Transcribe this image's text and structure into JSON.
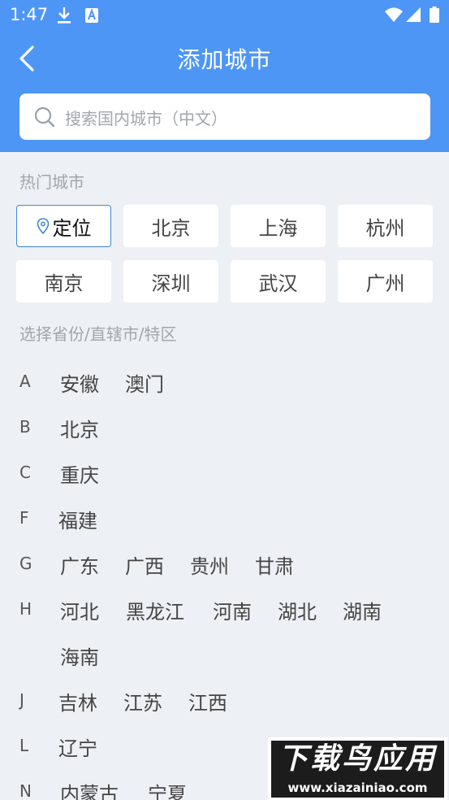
{
  "status_bar": {
    "time": "1:47"
  },
  "header": {
    "title": "添加城市"
  },
  "search": {
    "placeholder": "搜索国内城市（中文）"
  },
  "hot_cities": {
    "title": "热门城市",
    "locate_label": "定位",
    "cities": [
      "北京",
      "上海",
      "杭州",
      "南京",
      "深圳",
      "武汉",
      "广州"
    ]
  },
  "provinces": {
    "title": "选择省份/直辖市/特区",
    "groups": [
      {
        "letter": "A",
        "items": [
          "安徽",
          "澳门"
        ]
      },
      {
        "letter": "B",
        "items": [
          "北京"
        ]
      },
      {
        "letter": "C",
        "items": [
          "重庆"
        ]
      },
      {
        "letter": "F",
        "items": [
          "福建"
        ]
      },
      {
        "letter": "G",
        "items": [
          "广东",
          "广西",
          "贵州",
          "甘肃"
        ]
      },
      {
        "letter": "H",
        "items": [
          "河北",
          "黑龙江",
          "河南",
          "湖北",
          "湖南",
          "海南"
        ]
      },
      {
        "letter": "J",
        "items": [
          "吉林",
          "江苏",
          "江西"
        ]
      },
      {
        "letter": "L",
        "items": [
          "辽宁"
        ]
      },
      {
        "letter": "N",
        "items": [
          "内蒙古",
          "宁夏"
        ]
      }
    ]
  },
  "watermark": {
    "brand": "下载鸟应用",
    "url": "www.xiazainiao.com"
  }
}
